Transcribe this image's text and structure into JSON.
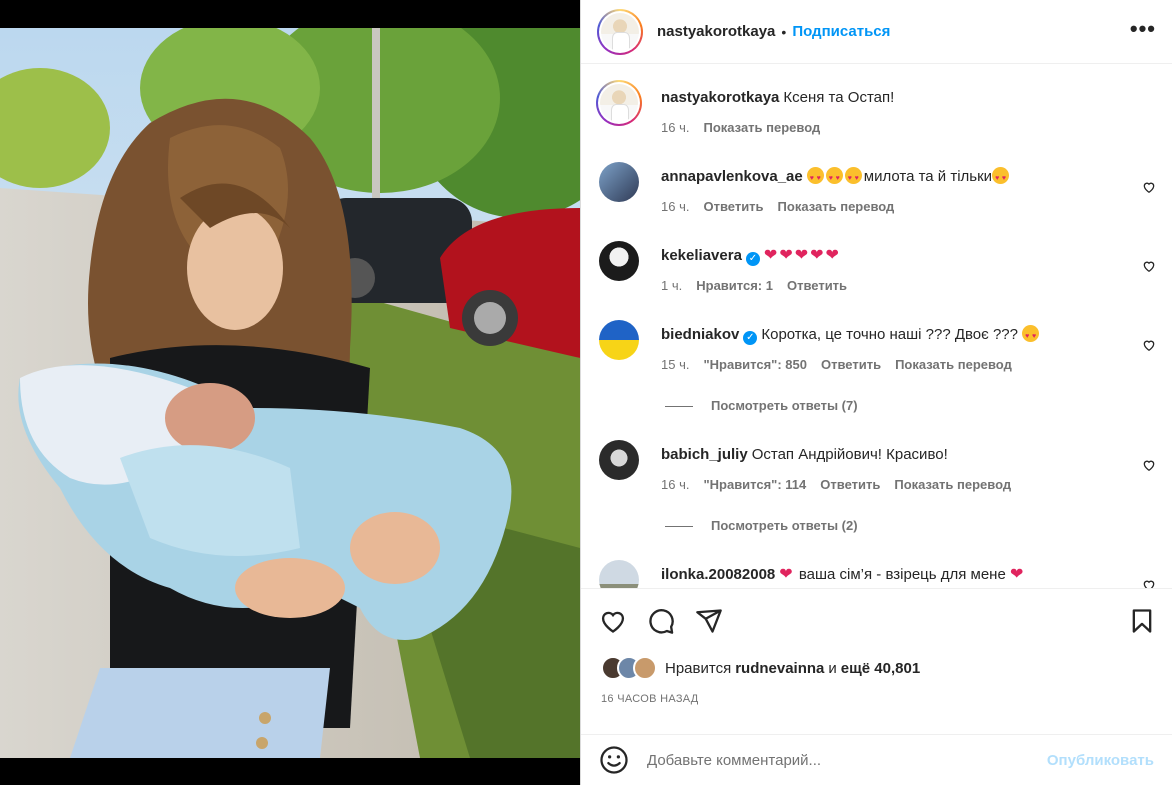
{
  "post": {
    "author": "nastyakorotkaya",
    "follow_label": "Подписаться",
    "separator": "•",
    "more_label": "•••",
    "caption": "Ксеня та Остап!",
    "caption_time": "16 ч.",
    "caption_translate": "Показать перевод"
  },
  "comments": [
    {
      "user": "annapavlenkova_ae",
      "verified": false,
      "text": "милота та й тільки",
      "time": "16 ч.",
      "likes": "",
      "reply": "Ответить",
      "translate": "Показать перевод"
    },
    {
      "user": "kekeliavera",
      "verified": true,
      "text": "",
      "time": "1 ч.",
      "likes": "Нравится: 1",
      "reply": "Ответить",
      "translate": ""
    },
    {
      "user": "biedniakov",
      "verified": true,
      "text": "Коротка, це точно наші ??? Двоє ???",
      "time": "15 ч.",
      "likes": "\"Нравится\": 850",
      "reply": "Ответить",
      "translate": "Показать перевод",
      "view_replies": "Посмотреть ответы (7)"
    },
    {
      "user": "babich_juliy",
      "verified": false,
      "text": "Остап Андрійович! Красиво!",
      "time": "16 ч.",
      "likes": "\"Нравится\": 114",
      "reply": "Ответить",
      "translate": "Показать перевод",
      "view_replies": "Посмотреть ответы (2)"
    },
    {
      "user": "ilonka.20082008",
      "verified": false,
      "text_a": "ваша сім’я - взірець для мене",
      "time": "",
      "likes": "",
      "reply": "",
      "translate": ""
    }
  ],
  "likes": {
    "prefix": "Нравится",
    "user": "rudnevainna",
    "joiner": "и",
    "rest": "ещё 40,801"
  },
  "timestamp": "16 ЧАСОВ НАЗАД",
  "add_comment": {
    "placeholder": "Добавьте комментарий...",
    "post_label": "Опубликовать"
  },
  "colors": {
    "accent": "#0095f6",
    "post_disabled": "#b2dffc",
    "heart_red": "#e0245e",
    "muted_text": "#737373"
  },
  "icons": [
    "like-icon",
    "comment-icon",
    "share-icon",
    "save-icon",
    "emoji-icon",
    "verified-icon",
    "more-icon"
  ]
}
